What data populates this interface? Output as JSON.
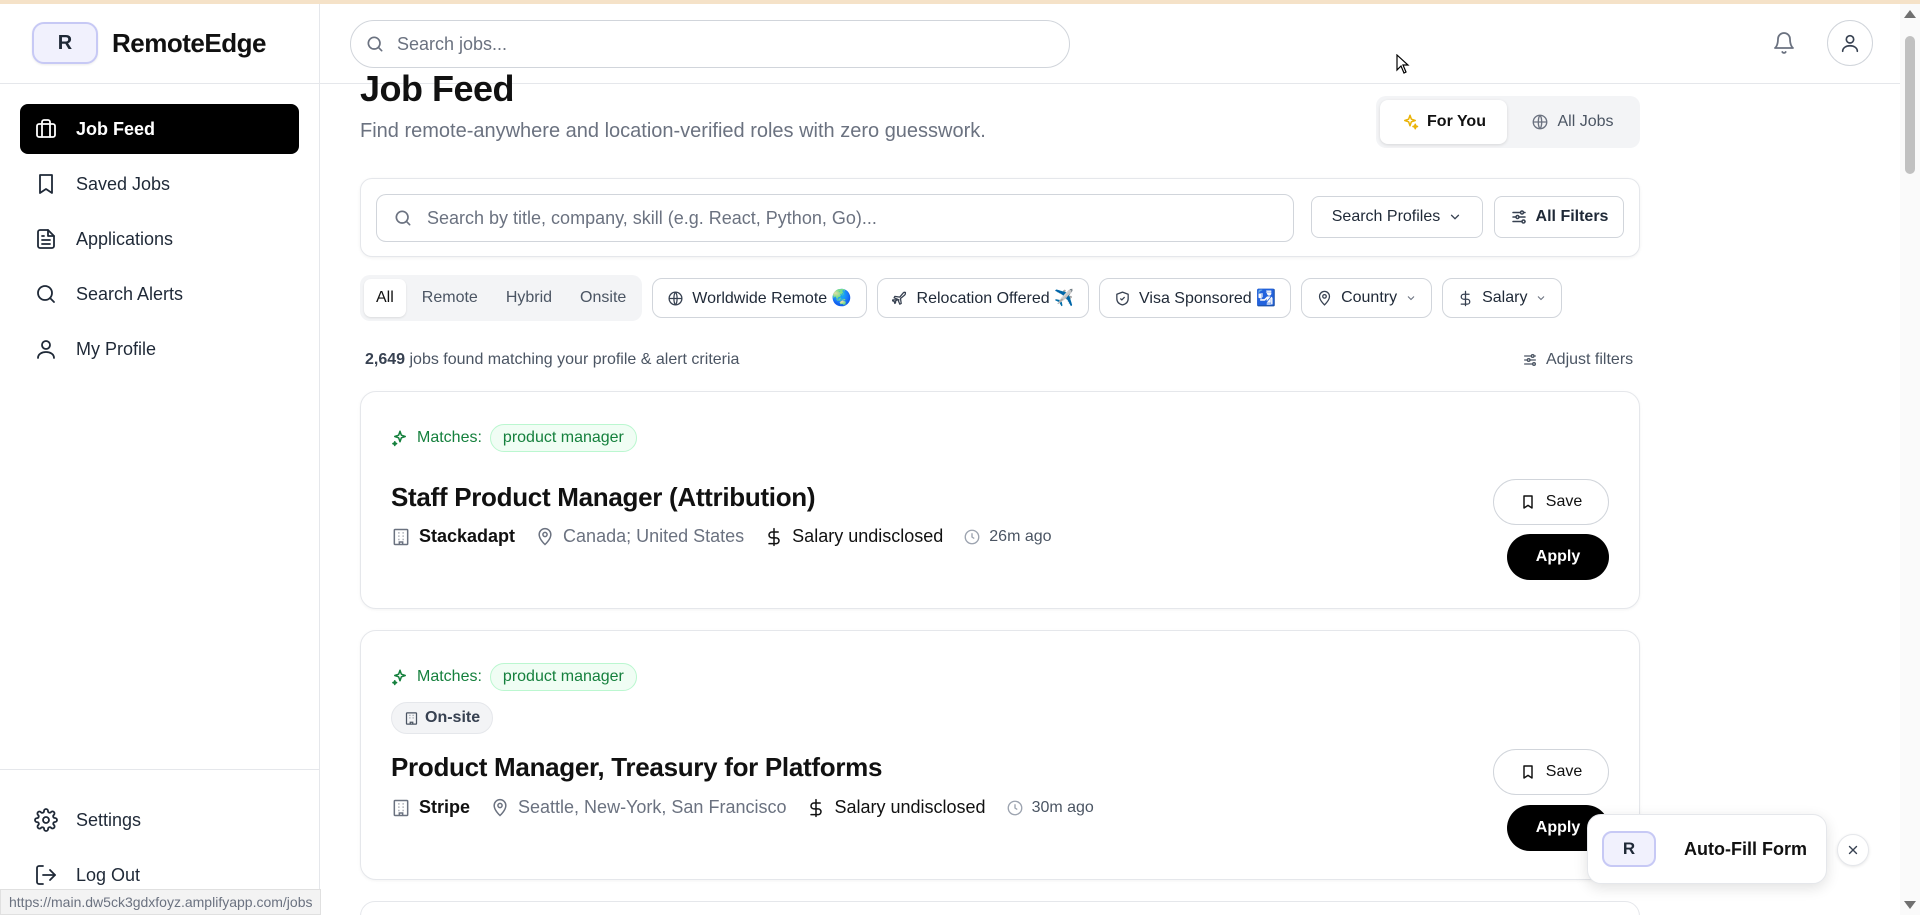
{
  "brand": {
    "logo_letter": "R",
    "name": "RemoteEdge"
  },
  "sidebar": {
    "items": [
      {
        "label": "Job Feed",
        "icon": "briefcase-icon",
        "active": true
      },
      {
        "label": "Saved Jobs",
        "icon": "bookmark-icon"
      },
      {
        "label": "Applications",
        "icon": "document-icon"
      },
      {
        "label": "Search Alerts",
        "icon": "search-icon"
      },
      {
        "label": "My Profile",
        "icon": "user-icon"
      }
    ],
    "bottom_items": [
      {
        "label": "Settings",
        "icon": "gear-icon"
      },
      {
        "label": "Log Out",
        "icon": "logout-icon"
      }
    ]
  },
  "header": {
    "search_placeholder": "Search jobs..."
  },
  "page": {
    "title": "Job Feed",
    "subtitle": "Find remote-anywhere and location-verified roles with zero guesswork.",
    "toggle": {
      "for_you": "For You",
      "all_jobs": "All Jobs",
      "active": "for_you"
    }
  },
  "filters": {
    "search_placeholder": "Search by title, company, skill (e.g. React, Python, Go)...",
    "search_profiles": "Search Profiles",
    "all_filters": "All Filters",
    "work_type": [
      "All",
      "Remote",
      "Hybrid",
      "Onsite"
    ],
    "work_type_active": "All",
    "chips": {
      "worldwide": "Worldwide Remote 🌏",
      "relocation": "Relocation Offered ✈️",
      "visa": "Visa Sponsored 🛂",
      "country": "Country",
      "salary": "Salary"
    }
  },
  "results": {
    "count": "2,649",
    "text": "jobs found matching your profile & alert criteria",
    "adjust": "Adjust filters"
  },
  "jobs": [
    {
      "matches_label": "Matches:",
      "match_tag": "product manager",
      "title": "Staff Product Manager (Attribution)",
      "company": "Stackadapt",
      "location": "Canada; United States",
      "salary": "Salary undisclosed",
      "posted": "26m ago",
      "save": "Save",
      "apply": "Apply"
    },
    {
      "matches_label": "Matches:",
      "match_tag": "product manager",
      "badge": "On-site",
      "title": "Product Manager, Treasury for Platforms",
      "company": "Stripe",
      "location": "Seattle, New-York, San Francisco",
      "salary": "Salary undisclosed",
      "posted": "30m ago",
      "save": "Save",
      "apply": "Apply"
    }
  ],
  "autofill": {
    "logo_letter": "R",
    "label": "Auto-Fill Form"
  },
  "status_url": "https://main.dw5ck3gdxfoyz.amplifyapp.com/jobs",
  "colors": {
    "accent_green": "#15803d",
    "active_nav": "#000000",
    "sparkle": "#eab308"
  }
}
